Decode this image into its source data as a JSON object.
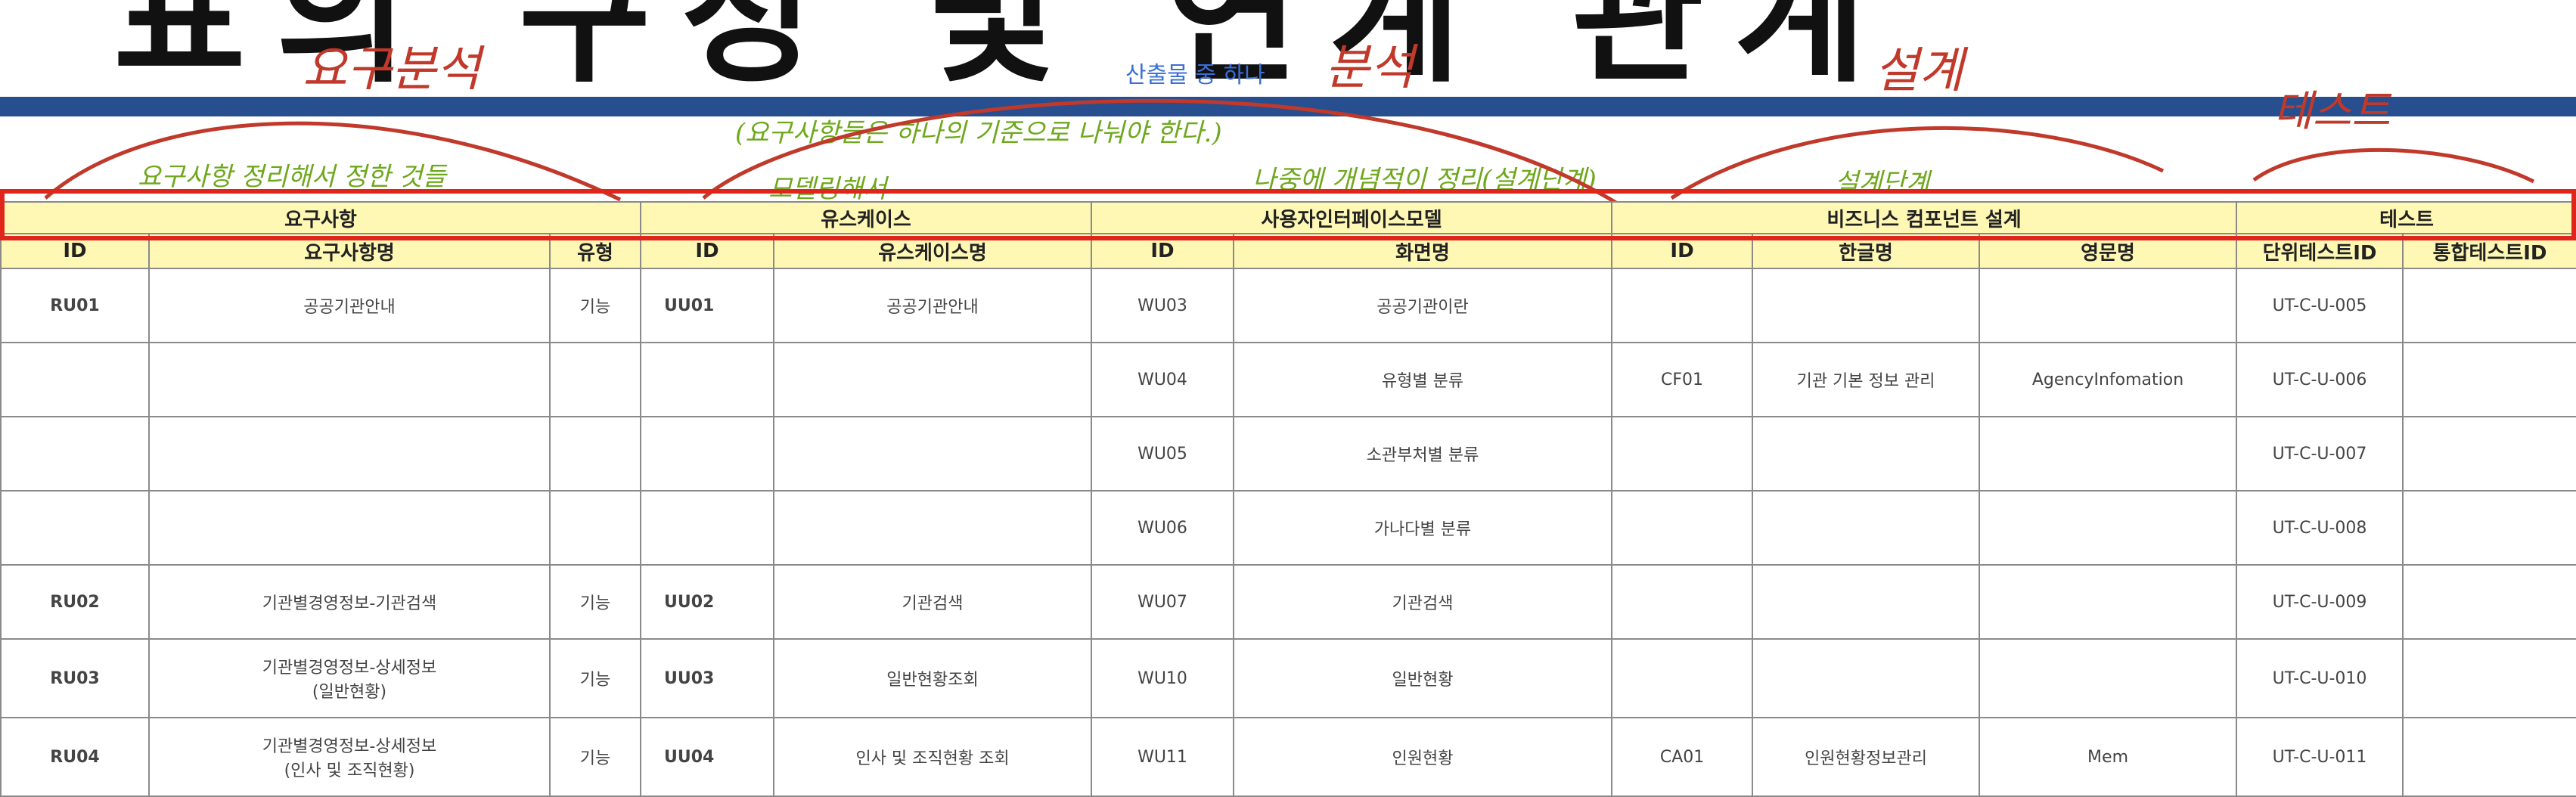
{
  "header": {
    "big_title": "표의 구성 및 연계 관계",
    "note_center": "산출물 중 하나"
  },
  "annotations": {
    "phase_requirements": "요구분석",
    "phase_analysis": "분석",
    "phase_design": "설계",
    "phase_test": "테스트",
    "req_note": "요구사항 정리해서 정한 것들",
    "uc_note": "(요구사항들은 하나의 기준으로 나눠야 한다.)",
    "uc_note2": "모델링해서",
    "ui_note": "나중에 개념적이 정리(설계단계)",
    "design_note": "설계단계"
  },
  "table": {
    "groups": [
      "요구사항",
      "유스케이스",
      "사용자인터페이스모델",
      "비즈니스 컴포넌트 설계",
      "테스트"
    ],
    "columns": [
      "ID",
      "요구사항명",
      "유형",
      "ID",
      "유스케이스명",
      "ID",
      "화면명",
      "ID",
      "한글명",
      "영문명",
      "단위테스트ID",
      "통합테스트ID"
    ],
    "rows": [
      {
        "rid": "RU01",
        "rname": "공공기관안내",
        "rtype": "기능",
        "uid": "UU01",
        "uname": "공공기관안내",
        "wid": "WU03",
        "wname": "공공기관이란",
        "cid": "",
        "kname": "",
        "ename": "",
        "unit": "UT-C-U-005",
        "integ": ""
      },
      {
        "rid": "",
        "rname": "",
        "rtype": "",
        "uid": "",
        "uname": "",
        "wid": "WU04",
        "wname": "유형별 분류",
        "cid": "CF01",
        "kname": "기관 기본 정보 관리",
        "ename": "AgencyInfomation",
        "unit": "UT-C-U-006",
        "integ": ""
      },
      {
        "rid": "",
        "rname": "",
        "rtype": "",
        "uid": "",
        "uname": "",
        "wid": "WU05",
        "wname": "소관부처별 분류",
        "cid": "",
        "kname": "",
        "ename": "",
        "unit": "UT-C-U-007",
        "integ": ""
      },
      {
        "rid": "",
        "rname": "",
        "rtype": "",
        "uid": "",
        "uname": "",
        "wid": "WU06",
        "wname": "가나다별 분류",
        "cid": "",
        "kname": "",
        "ename": "",
        "unit": "UT-C-U-008",
        "integ": ""
      },
      {
        "rid": "RU02",
        "rname": "기관별경영정보-기관검색",
        "rtype": "기능",
        "uid": "UU02",
        "uname": "기관검색",
        "wid": "WU07",
        "wname": "기관검색",
        "cid": "",
        "kname": "",
        "ename": "",
        "unit": "UT-C-U-009",
        "integ": ""
      },
      {
        "rid": "RU03",
        "rname": "기관별경영정보-상세정보\n(일반현황)",
        "rtype": "기능",
        "uid": "UU03",
        "uname": "일반현황조회",
        "wid": "WU10",
        "wname": "일반현황",
        "cid": "",
        "kname": "",
        "ename": "",
        "unit": "UT-C-U-010",
        "integ": ""
      },
      {
        "rid": "RU04",
        "rname": "기관별경영정보-상세정보\n(인사 및 조직현황)",
        "rtype": "기능",
        "uid": "UU04",
        "uname": "인사 및 조직현황 조회",
        "wid": "WU11",
        "wname": "인원현황",
        "cid": "CA01",
        "kname": "인원현황정보관리",
        "ename": "Mem",
        "unit": "UT-C-U-011",
        "integ": ""
      }
    ]
  },
  "colors": {
    "header_fill": "#fff8b5",
    "banner": "#274e8e",
    "annotation_red": "#c0392b",
    "annotation_green": "#6ea81d",
    "highlight_box": "#e0261b",
    "type_text": "#e33a2a"
  }
}
